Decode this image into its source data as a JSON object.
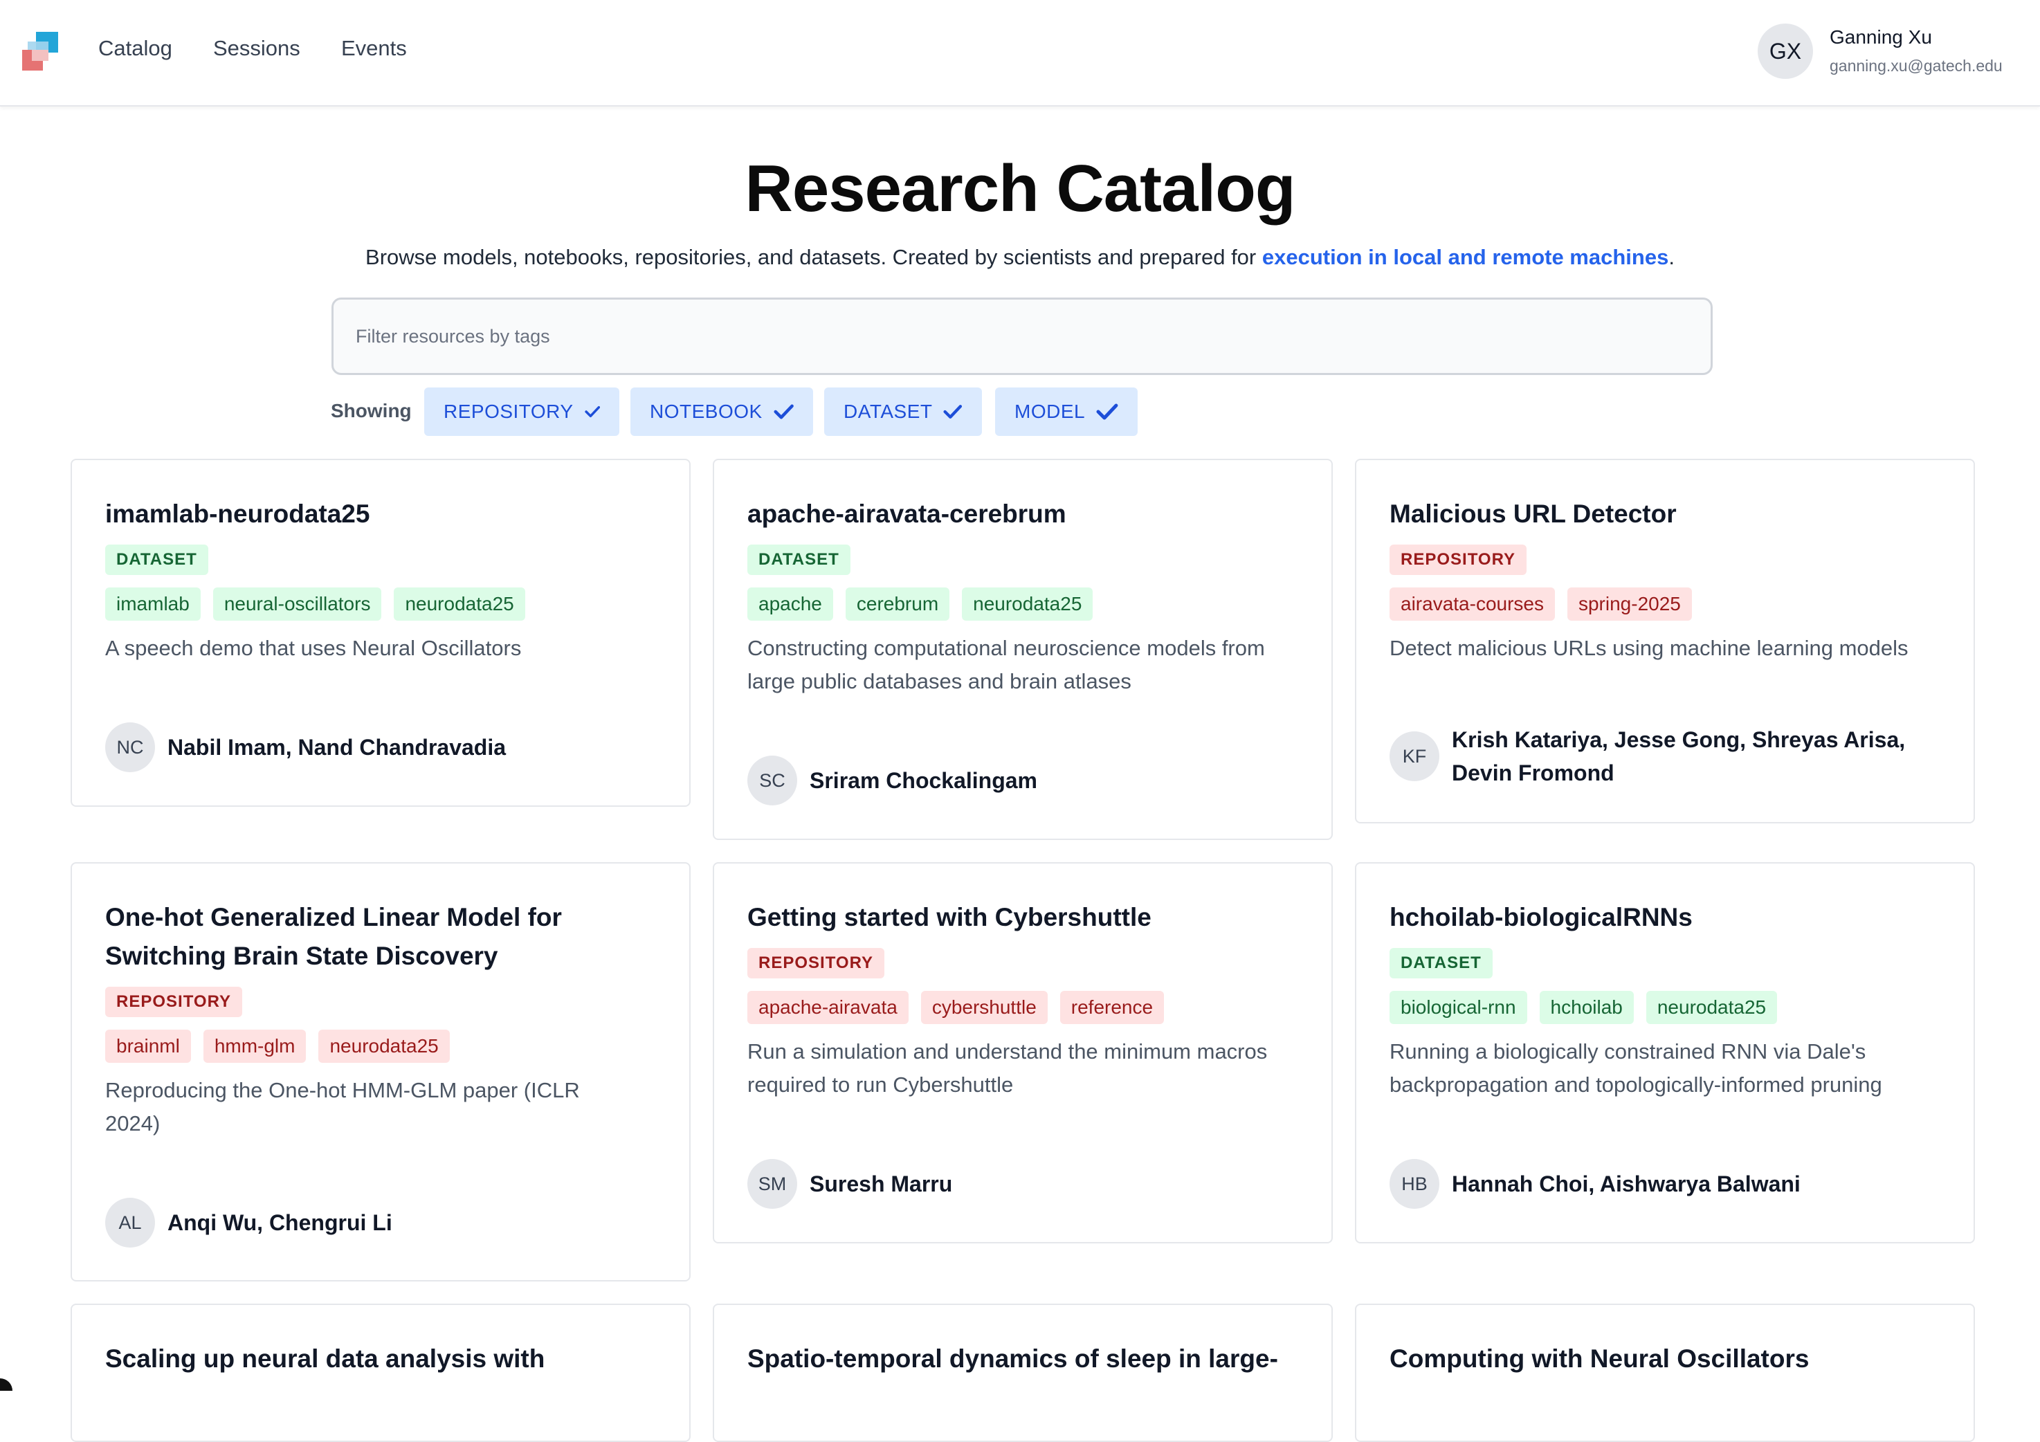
{
  "nav": {
    "links": [
      "Catalog",
      "Sessions",
      "Events"
    ],
    "user": {
      "initials": "GX",
      "name": "Ganning Xu",
      "email": "ganning.xu@gatech.edu"
    }
  },
  "header": {
    "title": "Research Catalog",
    "subtitle_text": "Browse models, notebooks, repositories, and datasets. Created by scientists and prepared for ",
    "subtitle_link": "execution in local and remote machines",
    "subtitle_end": "."
  },
  "filter": {
    "placeholder": "Filter resources by tags",
    "value": ""
  },
  "showing": {
    "label": "Showing",
    "chips": [
      "REPOSITORY",
      "NOTEBOOK",
      "DATASET",
      "MODEL"
    ]
  },
  "colors": {
    "accent": "#2563eb",
    "dataset": "#166534",
    "repository": "#991b1b"
  },
  "cards": [
    {
      "title": "imamlab-neurodata25",
      "type": "DATASET",
      "tags": [
        "imamlab",
        "neural-oscillators",
        "neurodata25"
      ],
      "description": "A speech demo that uses Neural Oscillators",
      "author_initials": "NC",
      "authors": "Nabil Imam, Nand Chandravadia"
    },
    {
      "title": "apache-airavata-cerebrum",
      "type": "DATASET",
      "tags": [
        "apache",
        "cerebrum",
        "neurodata25"
      ],
      "description": "Constructing computational neuroscience models from large public databases and brain atlases",
      "author_initials": "SC",
      "authors": "Sriram Chockalingam"
    },
    {
      "title": "Malicious URL Detector",
      "type": "REPOSITORY",
      "tags": [
        "airavata-courses",
        "spring-2025"
      ],
      "description": "Detect malicious URLs using machine learning models",
      "author_initials": "KF",
      "authors": "Krish Katariya, Jesse Gong, Shreyas Arisa, Devin Fromond"
    },
    {
      "title": "One-hot Generalized Linear Model for Switching Brain State Discovery",
      "type": "REPOSITORY",
      "tags": [
        "brainml",
        "hmm-glm",
        "neurodata25"
      ],
      "description": "Reproducing the One-hot HMM-GLM paper (ICLR 2024)",
      "author_initials": "AL",
      "authors": "Anqi Wu, Chengrui Li"
    },
    {
      "title": "Getting started with Cybershuttle",
      "type": "REPOSITORY",
      "tags": [
        "apache-airavata",
        "cybershuttle",
        "reference"
      ],
      "description": "Run a simulation and understand the minimum macros required to run Cybershuttle",
      "author_initials": "SM",
      "authors": "Suresh Marru"
    },
    {
      "title": "hchoilab-biologicalRNNs",
      "type": "DATASET",
      "tags": [
        "biological-rnn",
        "hchoilab",
        "neurodata25"
      ],
      "description": "Running a biologically constrained RNN via Dale's backpropagation and topologically-informed pruning",
      "author_initials": "HB",
      "authors": "Hannah Choi, Aishwarya Balwani"
    },
    {
      "title": "Scaling up neural data analysis with"
    },
    {
      "title": "Spatio-temporal dynamics of sleep in large-"
    },
    {
      "title": "Computing with Neural Oscillators"
    }
  ]
}
